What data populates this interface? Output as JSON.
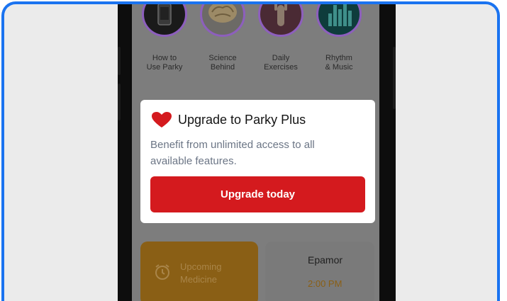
{
  "stories": [
    {
      "icon": "phone-app-icon",
      "line1": "How to",
      "line2": "Use Parky"
    },
    {
      "icon": "brain-icon",
      "line1": "Science",
      "line2": "Behind"
    },
    {
      "icon": "raised-hand-icon",
      "line1": "Daily",
      "line2": "Exercises"
    },
    {
      "icon": "equalizer-icon",
      "line1": "Rhythm",
      "line2": "& Music"
    }
  ],
  "modal": {
    "icon": "heart-icon",
    "title": "Upgrade to Parky Plus",
    "body_line1": "Benefit from unlimited access to all",
    "body_line2": "available features.",
    "button_label": "Upgrade today"
  },
  "medicine_card": {
    "icon": "alarm-clock-icon",
    "line1": "Upcoming",
    "line2": "Medicine"
  },
  "medicine_info": {
    "name": "Epamor",
    "time": "2:00 PM"
  },
  "colors": {
    "accent_red": "#d41a1e",
    "frame_blue": "#1a73f0",
    "medicine_orange": "#e09a22"
  }
}
